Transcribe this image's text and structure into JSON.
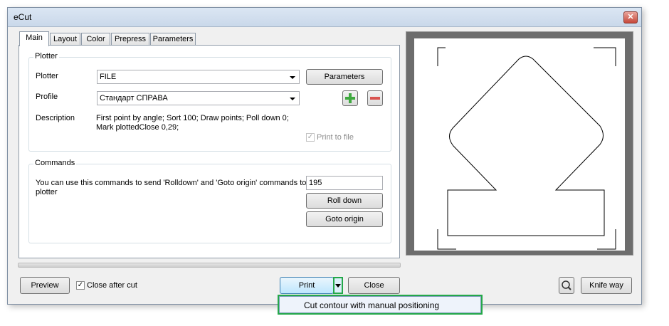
{
  "window": {
    "title": "eCut"
  },
  "tabs": [
    "Main",
    "Layout",
    "Color",
    "Prepress",
    "Parameters"
  ],
  "plotter_group": {
    "title": "Plotter",
    "plotter_label": "Plotter",
    "plotter_value": "FILE",
    "parameters_button": "Parameters",
    "profile_label": "Profile",
    "profile_value": "Стандарт СПРАВА",
    "description_label": "Description",
    "description_line1": "First point by angle; Sort 100; Draw points; Poll down 0;",
    "description_line2": "Mark plottedClose 0,29;",
    "print_to_file_label": "Print to file"
  },
  "commands_group": {
    "title": "Commands",
    "text_line1": "You can use this commands to send 'Rolldown' and 'Goto origin' commands to",
    "text_line2": "plotter",
    "value": "195",
    "roll_down_button": "Roll down",
    "goto_origin_button": "Goto origin"
  },
  "footer": {
    "preview_button": "Preview",
    "close_after_cut_label": "Close after cut",
    "print_button": "Print",
    "close_button": "Close",
    "knife_way_button": "Knife way"
  },
  "dropdown_menu": {
    "item": "Cut contour with manual positioning"
  },
  "colors": {
    "highlight": "#24a84a",
    "add": "#3fa93f",
    "remove": "#d9534f"
  }
}
